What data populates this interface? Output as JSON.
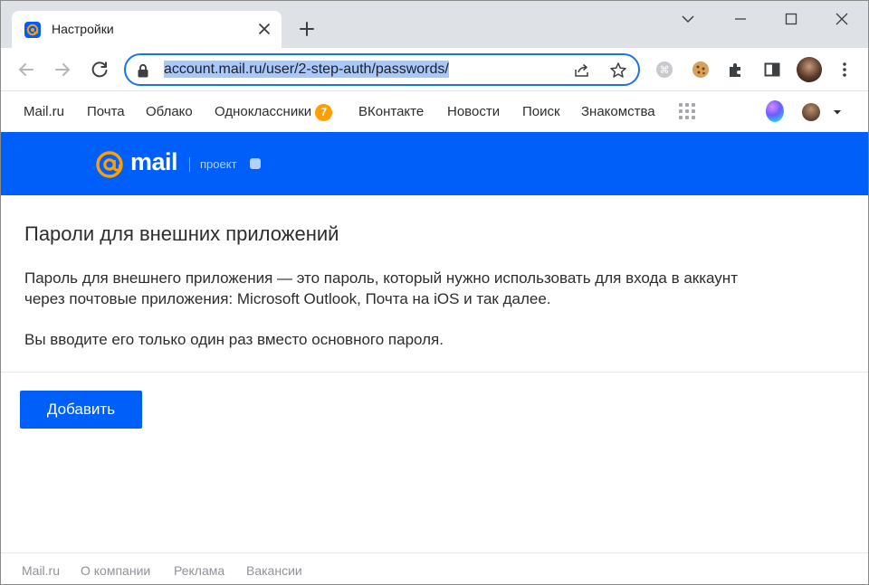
{
  "browser": {
    "tab": {
      "title": "Настройки"
    },
    "address_bar": {
      "url": "account.mail.ru/user/2-step-auth/passwords/"
    }
  },
  "portal_nav": {
    "items": [
      {
        "label": "Mail.ru"
      },
      {
        "label": "Почта"
      },
      {
        "label": "Облако"
      },
      {
        "label": "Одноклассники",
        "badge": "7"
      },
      {
        "label": "ВКонтакте"
      },
      {
        "label": "Новости"
      },
      {
        "label": "Поиск"
      },
      {
        "label": "Знакомства"
      }
    ]
  },
  "brand": {
    "logo_text": "mail",
    "project_label": "проект",
    "color": "#005ff9",
    "accent": "#ff9e00"
  },
  "content": {
    "heading": "Пароли для внешних приложений",
    "description_line1": "Пароль для внешнего приложения — это пароль, который нужно использовать для входа в аккаунт",
    "description_line2": "через почтовые приложения: Microsoft Outlook, Почта на iOS и так далее.",
    "note": "Вы вводите его только один раз вместо основного пароля.",
    "add_button": "Добавить"
  },
  "footer": {
    "links": [
      "Mail.ru",
      "О компании",
      "Реклама",
      "Вакансии"
    ]
  },
  "icons": [
    "mail-at-icon",
    "close-icon",
    "plus-icon",
    "minimize-icon",
    "maximize-icon",
    "chevron-down-icon",
    "back-arrow-icon",
    "forward-arrow-icon",
    "reload-icon",
    "lock-icon",
    "share-icon",
    "star-icon",
    "extension-icon",
    "cookie-icon",
    "puzzle-icon",
    "side-panel-icon",
    "profile-avatar",
    "kebab-menu-icon",
    "apps-grid-icon",
    "marusia-icon"
  ]
}
